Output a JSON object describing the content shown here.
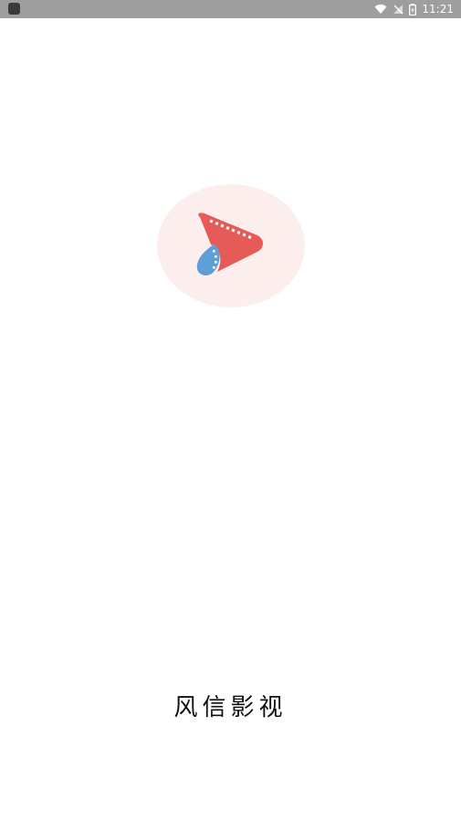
{
  "status_bar": {
    "time": "11:21",
    "icons": [
      "app-notification-icon",
      "wifi-icon",
      "no-signal-icon",
      "battery-charging-icon"
    ]
  },
  "splash": {
    "app_name": "风信影视",
    "logo_icon": "film-strip-play-logo",
    "colors": {
      "logo_red": "#e65a57",
      "logo_blue": "#5f9fd8",
      "logo_bg": "#fdeeee"
    }
  }
}
